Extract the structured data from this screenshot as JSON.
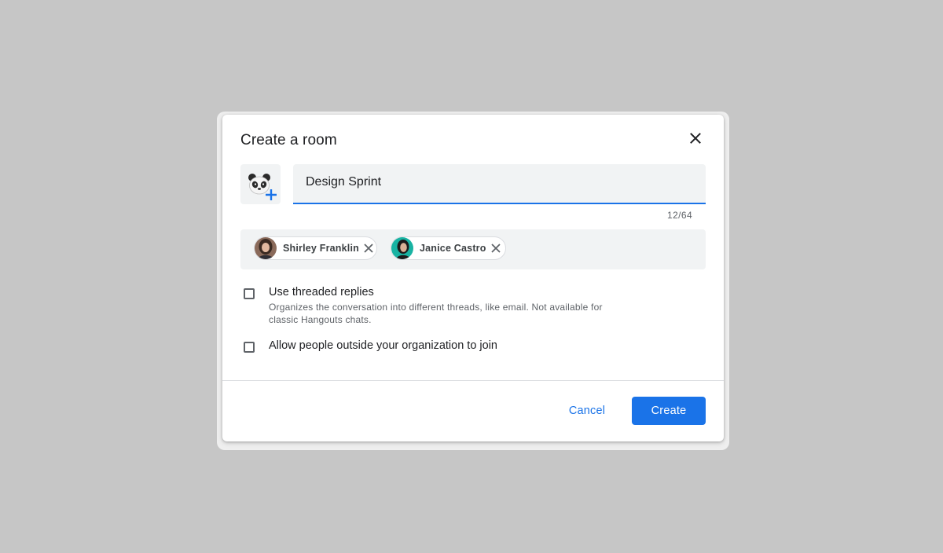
{
  "dialog": {
    "title": "Create a room",
    "close_icon": "close-icon"
  },
  "room_avatar": {
    "emoji_icon": "panda-icon",
    "add_icon": "plus-icon"
  },
  "room_name": {
    "value": "Design Sprint",
    "char_count": "12/64"
  },
  "members": [
    {
      "name": "Shirley Franklin",
      "remove_icon": "close-icon"
    },
    {
      "name": "Janice Castro",
      "remove_icon": "close-icon"
    }
  ],
  "options": [
    {
      "label": "Use threaded replies",
      "description": "Organizes the conversation into different threads, like email. Not available for classic Hangouts chats.",
      "checked": false
    },
    {
      "label": "Allow people outside your organization to join",
      "checked": false
    }
  ],
  "actions": {
    "cancel_label": "Cancel",
    "create_label": "Create"
  },
  "colors": {
    "accent": "#1a73e8",
    "backdrop": "#c6c6c6",
    "field_bg": "#f1f3f4"
  }
}
